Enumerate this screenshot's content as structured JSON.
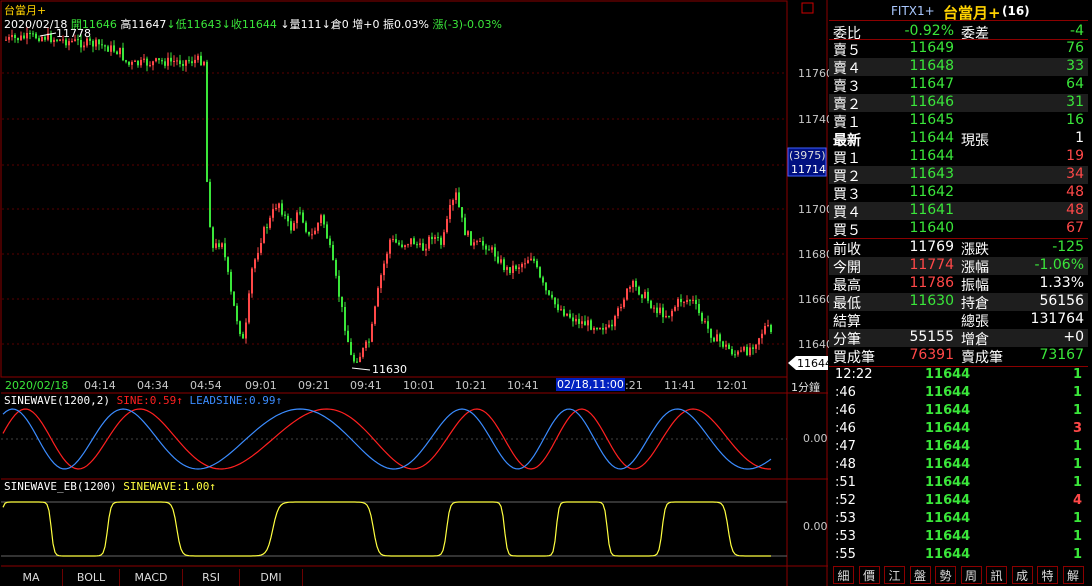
{
  "header": {
    "title": "台當月+",
    "date": "2020/02/18",
    "open_label": "開",
    "open": "11646",
    "high_label": "高",
    "high": "11647",
    "low_label": "↓低",
    "low": "11643",
    "close_label": "↓收",
    "close": "11644",
    "volume_label": "↓量",
    "volume": "111",
    "oi_label": "↓倉",
    "oi": "0",
    "oi_change": "增+0",
    "amplitude": "振0.03%",
    "change": "漲(-3)-0.03%"
  },
  "price_axis": {
    "labels": [
      "11760",
      "11740",
      "11720",
      "11700",
      "11680",
      "11660",
      "11640"
    ],
    "cursor_label": "(3975)",
    "cursor_price": "11714",
    "last_price_tag": "11644",
    "high_marker": "11778",
    "low_marker": "11630"
  },
  "time_axis": {
    "labels": [
      "2020/02/18",
      "04:14",
      "04:34",
      "04:54",
      "09:01",
      "09:21",
      "09:41",
      "10:01",
      "10:21",
      "10:41",
      ":21",
      "11:41",
      "12:01"
    ],
    "cursor_time": "02/18,11:00",
    "period": "1分鐘"
  },
  "indicators": {
    "sinewave": {
      "name": "SINEWAVE(1200,2)",
      "sine": "SINE:0.59↑",
      "leadsine": "LEADSINE:0.99↑",
      "zero_label": "0.00"
    },
    "sinewave_eb": {
      "name": "SINEWAVE_EB(1200)",
      "value": "SINEWAVE:1.00↑",
      "zero_label": "0.00"
    }
  },
  "bottom_buttons": [
    "MA",
    "BOLL",
    "MACD",
    "RSI",
    "DMI"
  ],
  "quote_panel": {
    "symbol": "FITX1+",
    "name": "台當月+",
    "count": "(16)",
    "ratio_label": "委比",
    "ratio": "-0.92%",
    "diff_label": "委差",
    "diff": "-4",
    "asks": [
      {
        "label": "賣５",
        "price": "11649",
        "qty": "76"
      },
      {
        "label": "賣４",
        "price": "11648",
        "qty": "33"
      },
      {
        "label": "賣３",
        "price": "11647",
        "qty": "64"
      },
      {
        "label": "賣２",
        "price": "11646",
        "qty": "31"
      },
      {
        "label": "賣１",
        "price": "11645",
        "qty": "16"
      }
    ],
    "last_label": "最新",
    "last": "11644",
    "cur_vol_label": "現張",
    "cur_vol": "1",
    "bids": [
      {
        "label": "買１",
        "price": "11644",
        "qty": "19"
      },
      {
        "label": "買２",
        "price": "11643",
        "qty": "34"
      },
      {
        "label": "買３",
        "price": "11642",
        "qty": "48"
      },
      {
        "label": "買４",
        "price": "11641",
        "qty": "48"
      },
      {
        "label": "買５",
        "price": "11640",
        "qty": "67"
      }
    ],
    "stats": [
      {
        "l1": "前收",
        "v1": "11769",
        "l2": "漲跌",
        "v2": "-125"
      },
      {
        "l1": "今開",
        "v1": "11774",
        "l2": "漲幅",
        "v2": "-1.06%"
      },
      {
        "l1": "最高",
        "v1": "11786",
        "l2": "振幅",
        "v2": "1.33%"
      },
      {
        "l1": "最低",
        "v1": "11630",
        "l2": "持倉",
        "v2": "56156"
      },
      {
        "l1": "結算",
        "v1": "",
        "l2": "總張",
        "v2": "131764"
      },
      {
        "l1": "分筆",
        "v1": "55155",
        "l2": "增倉",
        "v2": "+0"
      },
      {
        "l1": "買成筆",
        "v1": "76391",
        "l2": "賣成筆",
        "v2": "73167"
      }
    ],
    "ticks": [
      {
        "time": "12:22",
        "price": "11644",
        "qty": "1"
      },
      {
        "time": ":46",
        "price": "11644",
        "qty": "1"
      },
      {
        "time": ":46",
        "price": "11644",
        "qty": "1"
      },
      {
        "time": ":46",
        "price": "11644",
        "qty": "3"
      },
      {
        "time": ":47",
        "price": "11644",
        "qty": "1"
      },
      {
        "time": ":48",
        "price": "11644",
        "qty": "1"
      },
      {
        "time": ":51",
        "price": "11644",
        "qty": "1"
      },
      {
        "time": ":52",
        "price": "11644",
        "qty": "4"
      },
      {
        "time": ":53",
        "price": "11644",
        "qty": "1"
      },
      {
        "time": ":53",
        "price": "11644",
        "qty": "1"
      },
      {
        "time": ":55",
        "price": "11644",
        "qty": "1"
      }
    ],
    "tabs": [
      "細",
      "價",
      "江",
      "盤",
      "勢",
      "周",
      "訊",
      "成",
      "特",
      "解"
    ]
  },
  "colors": {
    "up": "#ff4848",
    "down": "#3ae63a",
    "border": "#8b0000",
    "sine": "#ff2020",
    "leadsine": "#3b8cff",
    "sinewave_eb": "#ffff40"
  }
}
